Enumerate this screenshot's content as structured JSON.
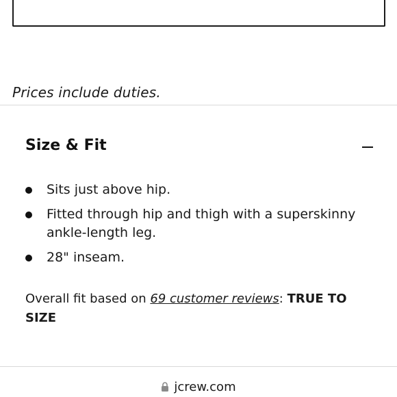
{
  "notice": {
    "prices_include": "Prices include duties."
  },
  "size_fit": {
    "title": "Size & Fit",
    "toggle_icon": "minus-icon",
    "bullets": [
      "Sits just above hip.",
      "Fitted through hip and thigh with a superskinny ankle-length leg.",
      "28\" inseam."
    ],
    "overall_prefix": "Overall fit based on ",
    "reviews_link": "69 customer reviews",
    "overall_sep": ": ",
    "verdict": "TRUE TO SIZE"
  },
  "browser": {
    "lock_icon": "lock-icon",
    "url": "jcrew.com"
  }
}
